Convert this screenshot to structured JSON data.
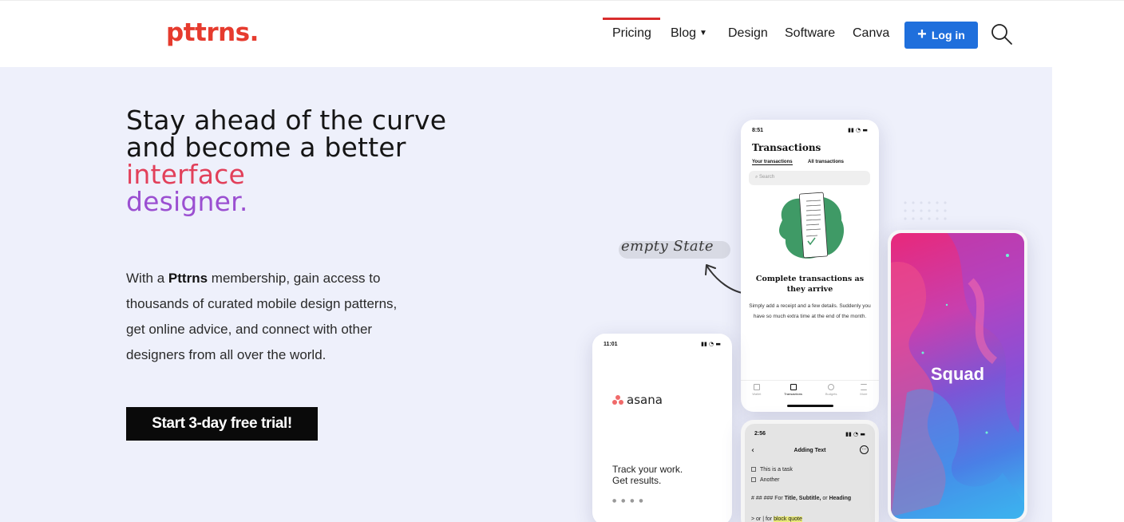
{
  "header": {
    "logo": "pttrns.",
    "nav": [
      {
        "label": "Pricing",
        "active": true
      },
      {
        "label": "Blog",
        "has_dropdown": true
      },
      {
        "label": "Design"
      },
      {
        "label": "Software"
      },
      {
        "label": "Canva"
      }
    ],
    "login_label": "Log in",
    "login_icon": "plus-icon",
    "search_icon": "search-icon"
  },
  "hero": {
    "headline_plain": "Stay ahead of the curve and become a better",
    "headline_accent1": "interface",
    "headline_accent2": "designer.",
    "description_pre": "With a",
    "description_brand": "Pttrns",
    "description_post": "membership, gain access to thousands of curated mobile design patterns, get online advice, and connect with other designers from all over the world.",
    "cta_label": "Start 3-day free trial!",
    "annotation": "empty State"
  },
  "phones": {
    "transactions": {
      "time": "8:51",
      "title": "Transactions",
      "tabs": [
        "Your transactions",
        "All transactions"
      ],
      "search_placeholder": "Search",
      "empty_title": "Complete transactions as they arrive",
      "empty_body": "Simply add a receipt and a few details. Suddenly you have so much extra time at the end of the month.",
      "tabbar": [
        "Wallet",
        "Transactions",
        "Budgets",
        "More"
      ]
    },
    "asana": {
      "time": "11:01",
      "brand": "asana",
      "tagline_1": "Track your work.",
      "tagline_2": "Get results."
    },
    "adding_text": {
      "time": "2:56",
      "title": "Adding Text",
      "task1": "This is a task",
      "task2": "Another",
      "hint_prefix": "# ## ### For",
      "hint_bold1": "Title, Subtitle,",
      "hint_mid": "or",
      "hint_bold2": "Heading",
      "hint_quote_prefix": "> or | for",
      "hint_quote": "block quote"
    },
    "squad": {
      "brand": "Squad"
    }
  },
  "colors": {
    "logo": "#e63b2e",
    "accent_blue": "#1f6fdc",
    "hero_bg": "#eef0fb",
    "headline_red": "#e2405a",
    "headline_purple": "#9b4fd1"
  }
}
